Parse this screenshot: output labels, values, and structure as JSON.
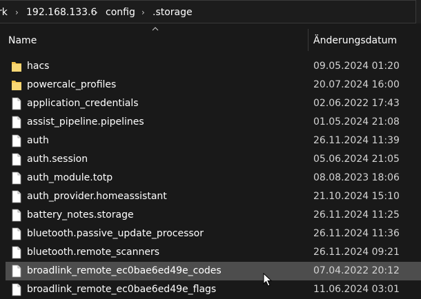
{
  "breadcrumb": {
    "items": [
      "rk",
      "192.168.133.6",
      "config",
      ".storage"
    ],
    "separator": "›"
  },
  "columns": {
    "name": "Name",
    "modified": "Änderungsdatum"
  },
  "colors": {
    "folder": "#f3c44c",
    "hover_row": "#4d4d4d"
  },
  "files": [
    {
      "name": "hacs",
      "date": "09.05.2024 01:20",
      "type": "folder",
      "icon": "folder-icon"
    },
    {
      "name": "powercalc_profiles",
      "date": "20.07.2024 16:00",
      "type": "folder",
      "icon": "folder-icon"
    },
    {
      "name": "application_credentials",
      "date": "02.06.2022 17:43",
      "type": "file",
      "icon": "file-icon"
    },
    {
      "name": "assist_pipeline.pipelines",
      "date": "01.05.2024 21:08",
      "type": "file",
      "icon": "file-icon"
    },
    {
      "name": "auth",
      "date": "26.11.2024 11:39",
      "type": "file",
      "icon": "file-icon"
    },
    {
      "name": "auth.session",
      "date": "05.06.2024 21:05",
      "type": "file",
      "icon": "file-icon"
    },
    {
      "name": "auth_module.totp",
      "date": "08.08.2023 18:06",
      "type": "file",
      "icon": "file-icon"
    },
    {
      "name": "auth_provider.homeassistant",
      "date": "21.10.2024 15:10",
      "type": "file",
      "icon": "file-icon"
    },
    {
      "name": "battery_notes.storage",
      "date": "26.11.2024 11:25",
      "type": "file",
      "icon": "file-icon"
    },
    {
      "name": "bluetooth.passive_update_processor",
      "date": "26.11.2024 11:36",
      "type": "file",
      "icon": "file-icon"
    },
    {
      "name": "bluetooth.remote_scanners",
      "date": "26.11.2024 09:21",
      "type": "file",
      "icon": "file-icon"
    },
    {
      "name": "broadlink_remote_ec0bae6ed49e_codes",
      "date": "07.04.2022 20:12",
      "type": "file",
      "icon": "file-icon",
      "hovered": true
    },
    {
      "name": "broadlink_remote_ec0bae6ed49e_flags",
      "date": "11.06.2024 03:01",
      "type": "file",
      "icon": "file-icon"
    }
  ]
}
